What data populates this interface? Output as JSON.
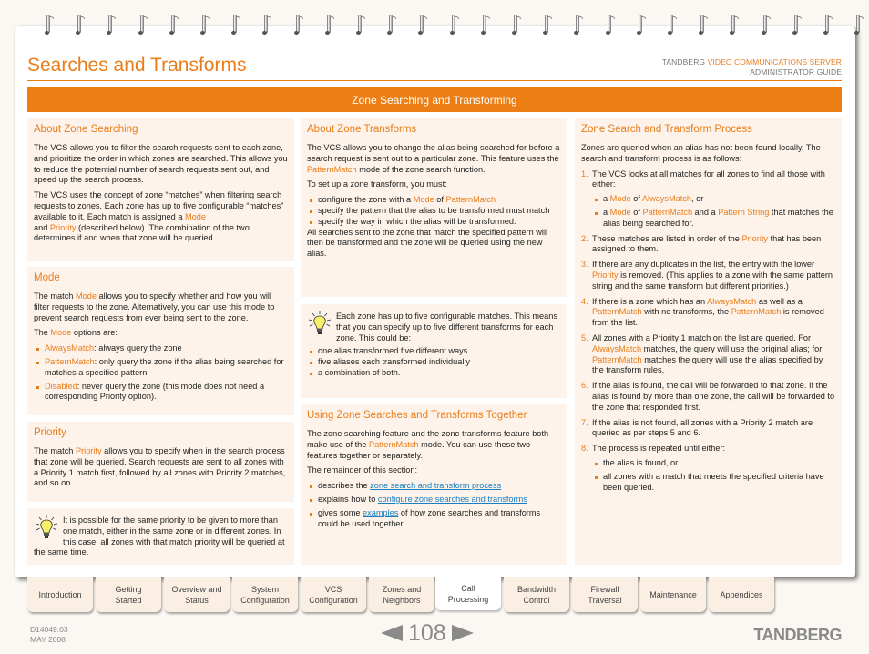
{
  "header": {
    "title": "Searches and Transforms",
    "guide_brand": "TANDBERG",
    "guide_product": "VIDEO COMMUNICATIONS SERVER",
    "guide_subtitle": "ADMINISTRATOR GUIDE",
    "section_title": "Zone Searching and Transforming"
  },
  "col1": {
    "about": {
      "heading": "About Zone Searching",
      "p1": "The VCS allows you to filter the search requests sent to each zone, and prioritize the order in which zones are searched.  This allows you to reduce the potential number of search requests sent out, and speed up the search process.",
      "p2_a": "The VCS uses the concept of zone “matches” when filtering search requests to zones.  Each zone has up to five configurable “matches” available to it.  Each match is assigned a ",
      "p2_mode": "Mode",
      "p2_b": " and ",
      "p2_priority": "Priority",
      "p2_c": " (described below).  The combination of the two determines if and when that zone will be queried."
    },
    "mode": {
      "heading": "Mode",
      "p1_a": "The match ",
      "p1_mode": "Mode",
      "p1_b": " allows you to specify whether and how you will filter requests to the zone.  Alternatively, you can use this mode to prevent search requests from ever being sent to the zone.",
      "p2_a": "The ",
      "p2_mode": "Mode",
      "p2_b": " options are:",
      "options": [
        {
          "name": "AlwaysMatch",
          "desc": ": always query the zone"
        },
        {
          "name": "PatternMatch",
          "desc": ": only query the zone if the alias being searched for matches a specified pattern"
        },
        {
          "name": "Disabled",
          "desc": ": never query the zone (this mode does not need a corresponding Priority option)."
        }
      ]
    },
    "priority": {
      "heading": "Priority",
      "p1_a": "The match ",
      "p1_priority": "Priority",
      "p1_b": " allows you to specify when in the search process that zone will be queried.  Search requests are sent to all zones with a Priority 1 match first, followed by all zones with Priority 2 matches, and so on."
    },
    "tip": {
      "text": "It is possible for the same priority to be given to more than one match, either in the same zone or in different zones.  In this case, all zones with that match priority will be queried at the same time."
    }
  },
  "col2": {
    "transforms": {
      "heading": "About Zone Transforms",
      "p1_a": "The VCS allows you to change the alias being searched for before a search request is sent out to a particular zone.  This feature uses the ",
      "p1_pm": "PatternMatch",
      "p1_b": " mode of the zone search function.",
      "p2": "To set up a zone transform, you must:",
      "b1_a": "configure the zone with a ",
      "b1_mode": "Mode",
      "b1_of": " of ",
      "b1_pm": "PatternMatch",
      "b2": "specify the pattern that the alias to be transformed must match",
      "b3": "specify the way in which the alias will be transformed.",
      "p3": "All searches sent to the zone that match the specified pattern will then be transformed and the zone will be queried using the new alias."
    },
    "tip": {
      "text": "Each zone has up to five configurable matches.  This means that you can specify up to five different transforms for each zone.  This could be:",
      "items": [
        "one alias transformed five different ways",
        "five aliases each transformed individually",
        "a combination of both."
      ]
    },
    "together": {
      "heading": "Using Zone Searches and Transforms Together",
      "p1_a": "The zone searching feature and the zone transforms feature both make use of the ",
      "p1_pm": "PatternMatch",
      "p1_b": " mode.  You can use these two features together or separately.",
      "p2": "The remainder of this section:",
      "b1_a": "describes the ",
      "b1_link": "zone search and transform process",
      "b2_a": "explains how to ",
      "b2_link": "configure zone searches and transforms",
      "b3_a": "gives some ",
      "b3_link": "examples",
      "b3_b": " of how zone searches and transforms could be used together."
    }
  },
  "col3": {
    "heading": "Zone Search and Transform Process",
    "intro": "Zones are queried when an alias has not been found locally.  The search and transform process is as follows:",
    "s1": {
      "n": "1.",
      "text": "The VCS looks at all matches for all zones to find all those with either:",
      "sub1_a": "a ",
      "sub1_mode": "Mode",
      "sub1_of": " of ",
      "sub1_am": "AlwaysMatch",
      "sub1_b": ", or",
      "sub2_a": "a ",
      "sub2_mode": "Mode",
      "sub2_of": " of ",
      "sub2_pm": "PatternMatch",
      "sub2_and": " and a ",
      "sub2_ps": "Pattern String",
      "sub2_b": " that matches the alias being searched for."
    },
    "s2": {
      "n": "2.",
      "a": "These matches are listed in order of the ",
      "priority": "Priority",
      "b": " that has been assigned to them."
    },
    "s3": {
      "n": "3.",
      "a": "If there are any duplicates in the list, the entry with the lower ",
      "priority": "Priority",
      "b": " is removed.  (This applies to a zone with the same pattern string and the same transform but different priorities.)"
    },
    "s4": {
      "n": "4.",
      "a": "If there is a zone which has an ",
      "am": "AlwaysMatch",
      "b": " as well as a ",
      "pm": "PatternMatch",
      "c": " with no transforms, the ",
      "pm2": "PatternMatch",
      "d": " is removed from the list."
    },
    "s5": {
      "n": "5.",
      "a": "All zones with a Priority 1 match on the list are queried.  For ",
      "am": "AlwaysMatch",
      "b": " matches, the query will use the original alias; for ",
      "pm": "PatternMatch",
      "c": " matches the query will use the alias specified by the transform rules."
    },
    "s6": {
      "n": "6.",
      "text": "If the alias is found, the call will be forwarded to that zone. If the alias is found by more than one zone, the call will be forwarded to the zone that responded first."
    },
    "s7": {
      "n": "7.",
      "text": "If the alias is not found, all zones with a Priority 2 match are queried as per steps 5 and 6."
    },
    "s8": {
      "n": "8.",
      "text": "The process is repeated until either:",
      "sub1": "the alias is found, or",
      "sub2": "all zones with a match that meets the specified criteria have been queried."
    }
  },
  "tabs": [
    {
      "label": "Introduction",
      "active": false
    },
    {
      "label": "Getting Started",
      "active": false
    },
    {
      "label": "Overview and Status",
      "active": false
    },
    {
      "label": "System Configuration",
      "active": false
    },
    {
      "label": "VCS Configuration",
      "active": false
    },
    {
      "label": "Zones and Neighbors",
      "active": false
    },
    {
      "label": "Call Processing",
      "active": true
    },
    {
      "label": "Bandwidth Control",
      "active": false
    },
    {
      "label": "Firewall Traversal",
      "active": false
    },
    {
      "label": "Maintenance",
      "active": false
    },
    {
      "label": "Appendices",
      "active": false
    }
  ],
  "footer": {
    "doc_id": "D14049.03",
    "date": "MAY 2008",
    "page_number": "108",
    "logo": "TANDBERG"
  },
  "colors": {
    "accent": "#ea7d1a",
    "section_bar": "#ec7e14",
    "box_bg": "#fdf3ea",
    "link": "#1a7fc1"
  }
}
